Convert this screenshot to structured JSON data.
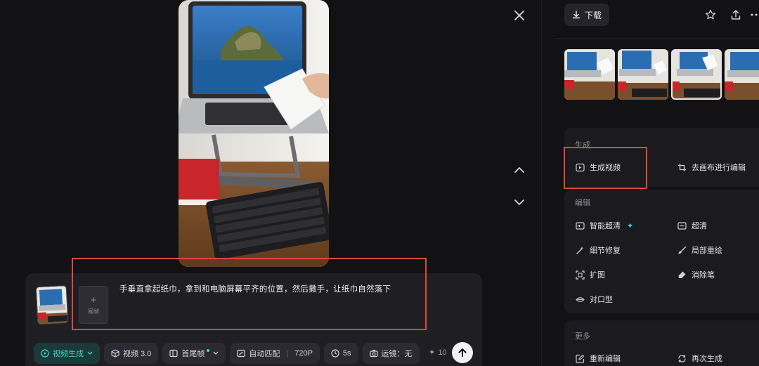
{
  "prompt": {
    "text": "手垂直拿起纸巾，拿到和电脑屏幕平齐的位置，然后撒手，让纸巾自然落下",
    "tail_frame_label": "尾帧"
  },
  "toolbar": {
    "mode_label": "视频生成",
    "model_label": "视频 3.0",
    "frame_label": "首尾帧",
    "ratio_label": "自动匹配",
    "resolution_label": "720P",
    "duration_label": "5s",
    "camera_label": "运镜：无",
    "credits": "10"
  },
  "header": {
    "download_label": "下载"
  },
  "generate_section": {
    "title": "生成",
    "generate_video_label": "生成视频",
    "canvas_edit_label": "去画布进行编辑"
  },
  "edit_section": {
    "title": "编辑",
    "items": [
      {
        "label": "智能超清",
        "icon": "hd-icon"
      },
      {
        "label": "超清",
        "icon": "hd-box-icon"
      },
      {
        "label": "细节修复",
        "icon": "magic-wand-icon"
      },
      {
        "label": "局部重绘",
        "icon": "brush-icon"
      },
      {
        "label": "扩图",
        "icon": "expand-icon"
      },
      {
        "label": "消除笔",
        "icon": "eraser-icon"
      },
      {
        "label": "对口型",
        "icon": "lip-sync-icon"
      }
    ]
  },
  "more_section": {
    "title": "更多",
    "re_edit_label": "重新编辑",
    "regenerate_label": "再次生成"
  },
  "colors": {
    "background": "#121214",
    "panel": "#1b1b1f",
    "accent": "#3fd4c6",
    "annotation": "#e0453d"
  }
}
